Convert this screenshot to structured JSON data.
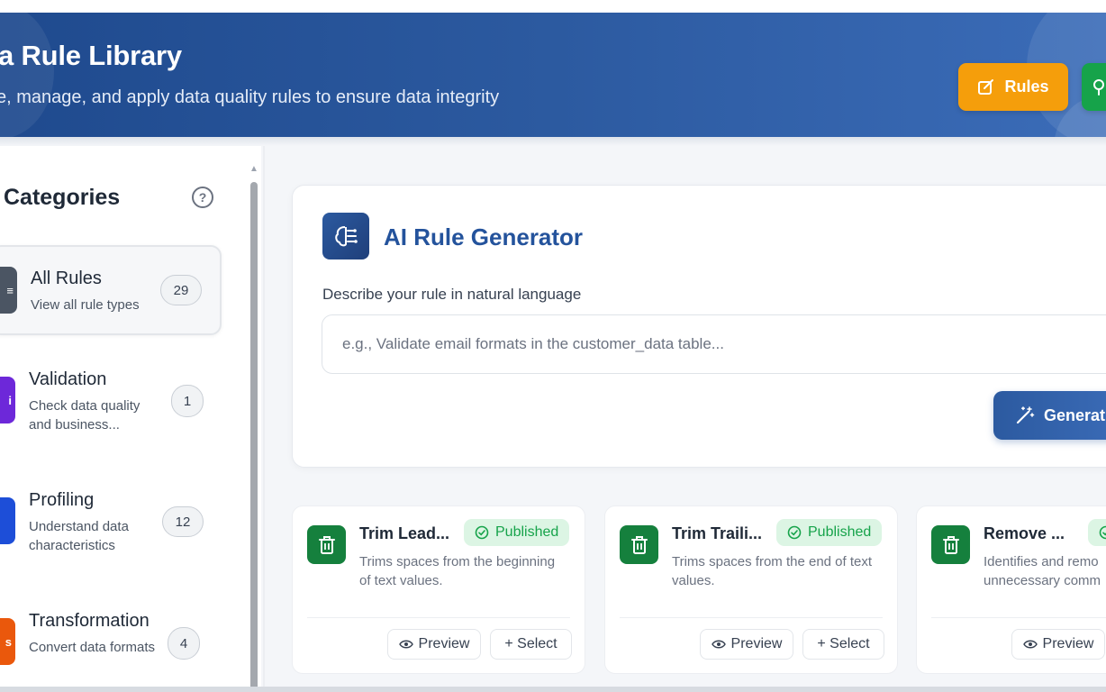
{
  "header": {
    "title": "a Rule Library",
    "subtitle": "e, manage, and apply data quality rules to ensure data integrity",
    "rules_button": "Rules"
  },
  "sidebar": {
    "title": "Categories",
    "help": "?",
    "categories": [
      {
        "name": "All Rules",
        "desc": "View all rule types",
        "count": "29",
        "color": "#4b5563",
        "icon_glyph": "≡"
      },
      {
        "name": "Validation",
        "desc": "Check data quality and business...",
        "count": "1",
        "color": "#6d28d9",
        "icon_glyph": "i"
      },
      {
        "name": "Profiling",
        "desc": "Understand data characteristics",
        "count": "12",
        "color": "#1d4ed8",
        "icon_glyph": ""
      },
      {
        "name": "Transformation",
        "desc": "Convert data formats",
        "count": "4",
        "color": "#ea580c",
        "icon_glyph": "s"
      }
    ]
  },
  "generator": {
    "title": "AI Rule Generator",
    "label": "Describe your rule in natural language",
    "placeholder": "e.g., Validate email formats in the customer_data table...",
    "button": "Generat"
  },
  "rules": [
    {
      "name": "Trim Lead...",
      "status": "Published",
      "desc": "Trims spaces from the beginning of text values.",
      "preview": "Preview",
      "select": "+ Select"
    },
    {
      "name": "Trim Traili...",
      "status": "Published",
      "desc": "Trims spaces from the end of text values.",
      "preview": "Preview",
      "select": "+ Select"
    },
    {
      "name": "Remove ...",
      "status": "",
      "desc": "Identifies and remo unnecessary comm",
      "preview": "Preview",
      "select": ""
    }
  ],
  "colors": {
    "header": "#2c5aa0",
    "rules_button": "#f59e0b",
    "published": "#16a34a",
    "rule_icon": "#15803d"
  }
}
